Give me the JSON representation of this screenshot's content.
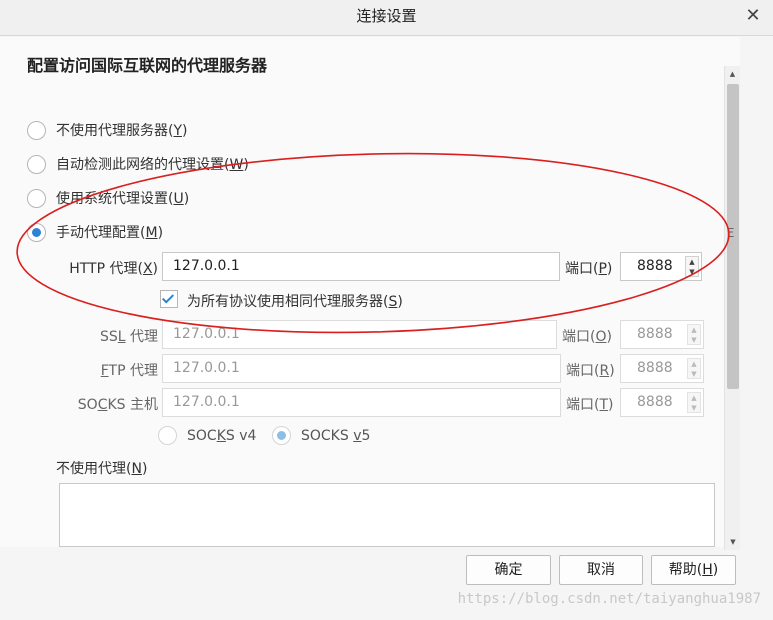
{
  "window": {
    "title": "连接设置",
    "close_glyph": "✕"
  },
  "heading": "配置访问国际互联网的代理服务器",
  "proxy_options": [
    {
      "text": "不使用代理服务器(",
      "key": "Y",
      "end": ")"
    },
    {
      "text": "自动检测此网络的代理设置(",
      "key": "W",
      "end": ")"
    },
    {
      "text": "使用系统代理设置(",
      "key": "U",
      "end": ")"
    },
    {
      "text": "手动代理配置(",
      "key": "M",
      "end": ")"
    }
  ],
  "http": {
    "label": "HTTP 代理(",
    "key": "X",
    "end": ")",
    "value": "127.0.0.1",
    "port_label": "端口(",
    "port_key": "P",
    "port_end": ")",
    "port": "8888"
  },
  "same_proxy": {
    "text": "为所有协议使用相同代理服务器(",
    "key": "S",
    "end": ")",
    "checked": true
  },
  "ssl": {
    "label_pre": "SS",
    "key": "L",
    "label_post": " 代理",
    "value": "127.0.0.1",
    "port_label": "端口(",
    "port_key": "O",
    "port_end": ")",
    "port": "8888"
  },
  "ftp": {
    "key": "F",
    "label_post": "TP 代理",
    "value": "127.0.0.1",
    "port_label": "端口(",
    "port_key": "R",
    "port_end": ")",
    "port": "8888"
  },
  "socks": {
    "label_pre": "SO",
    "key": "C",
    "label_post": "KS 主机",
    "value": "127.0.0.1",
    "port_label": "端口(",
    "port_key": "T",
    "port_end": ")",
    "port": "8888"
  },
  "socks_version": {
    "v4_pre": "SOC",
    "v4_key": "K",
    "v4_post": "S v4",
    "v5_pre": "SOCKS ",
    "v5_key": "v",
    "v5_post": "5",
    "selected": "v5"
  },
  "no_proxy": {
    "label": "不使用代理(",
    "key": "N",
    "end": ")",
    "value": ""
  },
  "side_mark": "Ξ",
  "buttons": {
    "ok": "确定",
    "cancel": "取消",
    "help_text": "帮助(",
    "help_key": "H",
    "help_end": ")"
  },
  "watermark": "https://blog.csdn.net/taiyanghua1987",
  "colors": {
    "accent": "#2a83d4",
    "annotation": "#d9201f"
  }
}
